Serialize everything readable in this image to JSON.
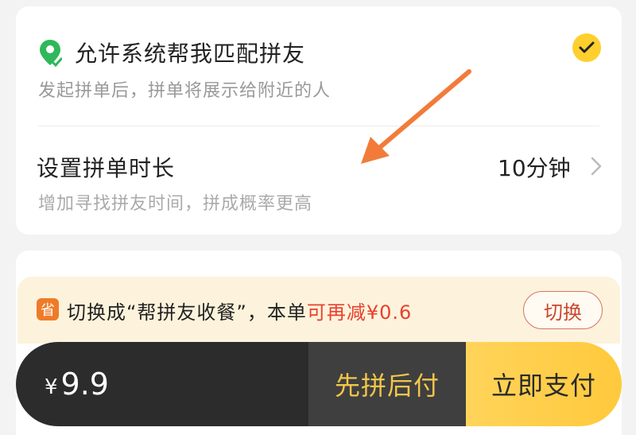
{
  "match_setting": {
    "title": "允许系统帮我匹配拼友",
    "subtitle": "发起拼单后，拼单将展示给附近的人",
    "checked": true
  },
  "duration_setting": {
    "title": "设置拼单时长",
    "subtitle": "增加寻找拼友时间，拼成概率更高",
    "value": "10分钟"
  },
  "promo": {
    "badge": "省",
    "text_prefix": "切换成“帮拼友收餐”，本单",
    "text_highlight": "可再减¥0.6",
    "switch_label": "切换"
  },
  "paybar": {
    "currency": "¥",
    "amount": "9.9",
    "pay_later_label": "先拼后付",
    "pay_now_label": "立即支付"
  },
  "colors": {
    "accent_yellow": "#ffcf2e",
    "highlight_red": "#e8412e",
    "location_green": "#2fb85a",
    "annotation_arrow": "#f27b3a"
  },
  "icons": {
    "location": "location-pin-icon",
    "check": "check-circle-icon",
    "chevron": "chevron-right-icon",
    "annotation": "annotation-arrow-icon"
  }
}
